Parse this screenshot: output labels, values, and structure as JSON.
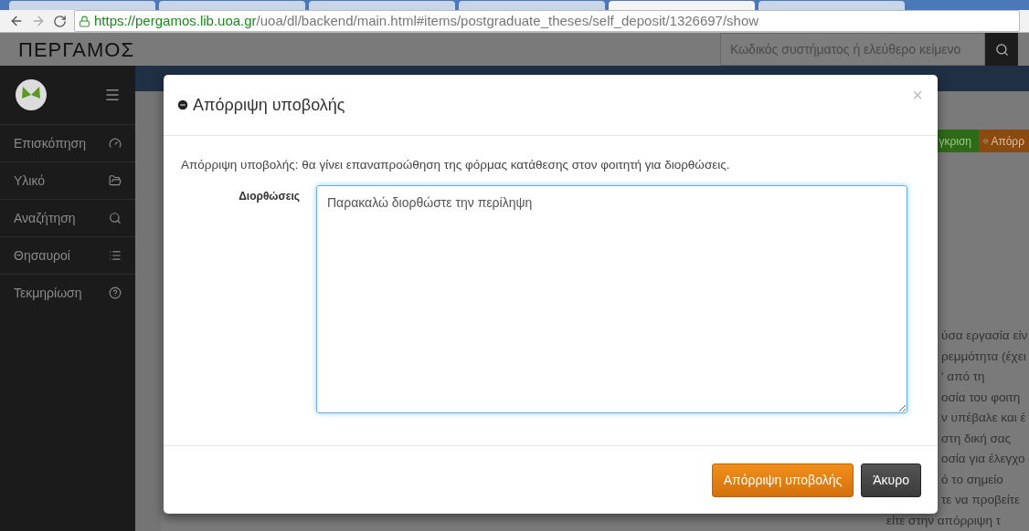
{
  "browser": {
    "tabs": [
      {
        "selected": false
      },
      {
        "selected": false
      },
      {
        "selected": false
      },
      {
        "selected": false
      },
      {
        "selected": true
      },
      {
        "selected": false
      }
    ],
    "url_host": "https://pergamos.lib.uoa.gr",
    "url_path": "/uoa/dl/backend/main.html#items/postgraduate_theses/self_deposit/1326697/show"
  },
  "header": {
    "logo": "ΠΕΡΓΑΜΟΣ",
    "search": {
      "placeholder": "Κωδικός συστήματος ή ελεύθερο κείμενο"
    }
  },
  "sidebar": {
    "items": [
      {
        "label": "Επισκόπηση"
      },
      {
        "label": "Υλικό"
      },
      {
        "label": "Αναζήτηση"
      },
      {
        "label": "Θησαυροί"
      },
      {
        "label": "Τεκμηρίωση"
      }
    ]
  },
  "background": {
    "buttons": [
      {
        "label": "γκριση",
        "kind": "approve"
      },
      {
        "label": "Απόρρ",
        "kind": "reject"
      }
    ],
    "text_lines": [
      "ύσα εργασία είν",
      "ρεμμότητα (έχει",
      "' από τη",
      "οσία του φοιτη",
      "ν υπέβαλε και έ",
      "στη δική σας",
      "οσία για έλεγχο",
      "ό το σημείο",
      "τε να προβείτε",
      "είτε στην απόρριψη τ"
    ]
  },
  "modal": {
    "title": "Απόρριψη υποβολής",
    "close": "×",
    "message": "Απόρριψη υποβολής: θα γίνει επαναπροώθηση της φόρμας κατάθεσης στον φοιτητή για διορθώσεις.",
    "field_label": "Διορθώσεις",
    "field_value": "Παρακαλώ διορθώστε την περίληψη",
    "buttons": [
      {
        "label": "Απόρριψη υποβολής",
        "kind": "primary"
      },
      {
        "label": "Άκυρο",
        "kind": "secondary"
      }
    ]
  }
}
